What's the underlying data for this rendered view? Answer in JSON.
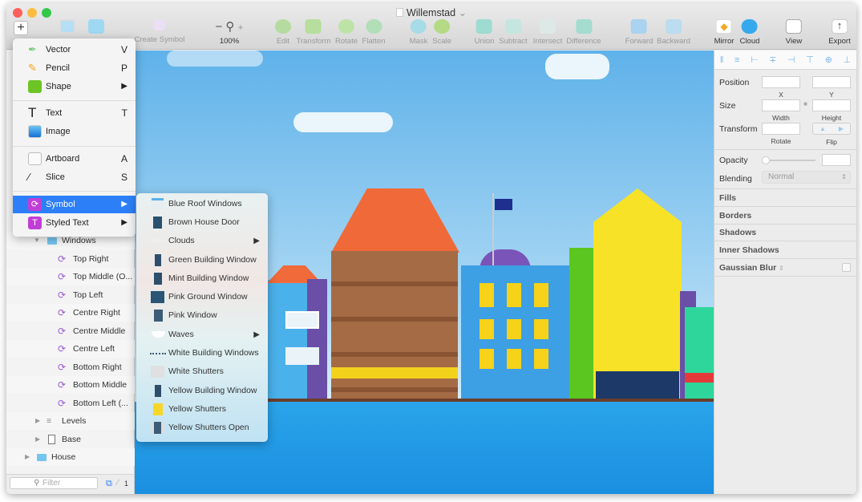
{
  "window": {
    "title": "Willemstad",
    "title_caret": "⌄"
  },
  "toolbar": {
    "insert": "+",
    "create_symbol": "Create Symbol",
    "zoom_minus": "−",
    "zoom_plus": "+",
    "zoom_level": "100%",
    "edit": "Edit",
    "transform": "Transform",
    "rotate": "Rotate",
    "flatten": "Flatten",
    "mask": "Mask",
    "scale": "Scale",
    "union": "Union",
    "subtract": "Subtract",
    "intersect": "Intersect",
    "difference": "Difference",
    "forward": "Forward",
    "backward": "Backward",
    "mirror": "Mirror",
    "cloud": "Cloud",
    "view": "View",
    "export": "Export"
  },
  "insert_menu": {
    "items": [
      {
        "label": "Vector",
        "shortcut": "V"
      },
      {
        "label": "Pencil",
        "shortcut": "P"
      },
      {
        "label": "Shape",
        "shortcut": "▶"
      },
      {
        "label": "Text",
        "shortcut": "T"
      },
      {
        "label": "Image",
        "shortcut": ""
      },
      {
        "label": "Artboard",
        "shortcut": "A"
      },
      {
        "label": "Slice",
        "shortcut": "S"
      },
      {
        "label": "Symbol",
        "shortcut": "▶"
      },
      {
        "label": "Styled Text",
        "shortcut": "▶"
      }
    ],
    "selected": "Symbol"
  },
  "symbol_submenu": {
    "items": [
      {
        "label": "Blue Roof Windows",
        "arrow": ""
      },
      {
        "label": "Brown House Door",
        "arrow": ""
      },
      {
        "label": "Clouds",
        "arrow": "▶"
      },
      {
        "label": "Green Building Window",
        "arrow": ""
      },
      {
        "label": "Mint Building Window",
        "arrow": ""
      },
      {
        "label": "Pink Ground Window",
        "arrow": ""
      },
      {
        "label": "Pink Window",
        "arrow": ""
      },
      {
        "label": "Waves",
        "arrow": "▶"
      },
      {
        "label": "White Building Windows",
        "arrow": ""
      },
      {
        "label": "White Shutters",
        "arrow": ""
      },
      {
        "label": "Yellow Building Window",
        "arrow": ""
      },
      {
        "label": "Yellow Shutters",
        "arrow": ""
      },
      {
        "label": "Yellow Shutters Open",
        "arrow": ""
      }
    ]
  },
  "layers": {
    "group": "Windows",
    "symbols": [
      "Top Right",
      "Top Middle (O...",
      "Top Left",
      "Centre Right",
      "Centre Middle",
      "Centre Left",
      "Bottom Right",
      "Bottom Middle",
      "Bottom Left (..."
    ],
    "levels": "Levels",
    "base": "Base",
    "house": "House",
    "filter_placeholder": "Filter",
    "page_count": "1"
  },
  "inspector": {
    "position": "Position",
    "x": "X",
    "y": "Y",
    "size": "Size",
    "width": "Width",
    "height": "Height",
    "transform": "Transform",
    "rotate": "Rotate",
    "flip": "Flip",
    "opacity": "Opacity",
    "opacity_value": 0,
    "blending": "Blending",
    "blending_value": "Normal",
    "sections": [
      "Fills",
      "Borders",
      "Shadows",
      "Inner Shadows",
      "Gaussian Blur"
    ],
    "blur_toggle": "⌃⌄"
  },
  "colors": {
    "selection": "#2d7ff7",
    "symbol": "#9a5bd0",
    "sky": "#5fb2ea",
    "water": "#1b8fe0"
  }
}
